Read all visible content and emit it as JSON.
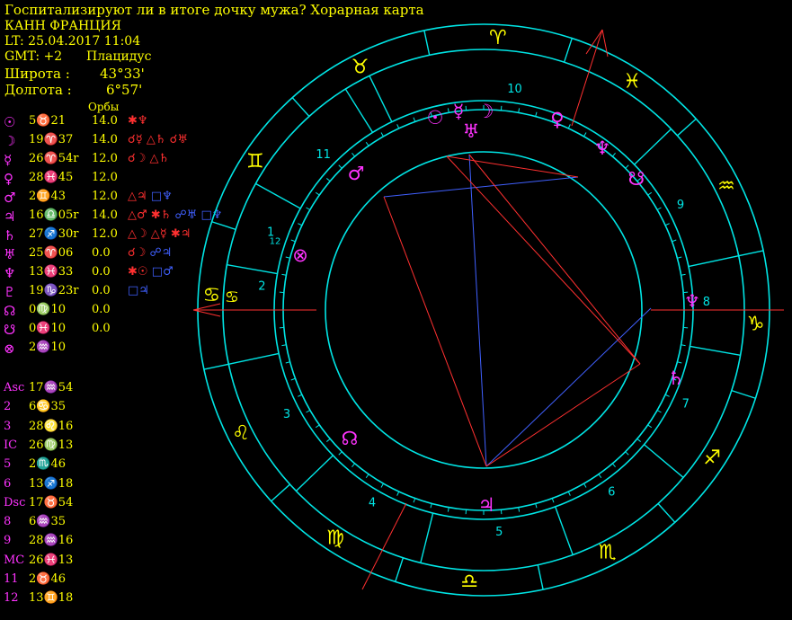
{
  "header": {
    "title": "Госпитализируют ли в итоге дочку мужа? Хорарная карта",
    "place": "КАНН ФРАНЦИЯ",
    "local_time": "LT: 25.04.2017  11:04",
    "gmt": "GMT: +2",
    "house_system": "Плацидус",
    "latitude_label": "Широта :",
    "latitude_value": "43°33'",
    "longitude_label": "Долгота :",
    "longitude_value": "6°57'",
    "orbs_label": "Орбы"
  },
  "planets": [
    {
      "glyph": "☉",
      "pos": "5♉21",
      "orb": "14.0",
      "aspects": [
        {
          "t": "✱♆",
          "c": "red"
        }
      ]
    },
    {
      "glyph": "☽",
      "pos": "19♈37",
      "orb": "14.0",
      "aspects": [
        {
          "t": "☌☿ ",
          "c": "red"
        },
        {
          "t": "△♄ ",
          "c": "red"
        },
        {
          "t": "☌♅",
          "c": "red"
        }
      ]
    },
    {
      "glyph": "☿",
      "pos": "26♈54r",
      "orb": "12.0",
      "aspects": [
        {
          "t": "☌☽ ",
          "c": "red"
        },
        {
          "t": "△♄",
          "c": "red"
        }
      ]
    },
    {
      "glyph": "♀",
      "pos": "28♓45",
      "orb": "12.0",
      "aspects": []
    },
    {
      "glyph": "♂",
      "pos": "2♊43",
      "orb": "12.0",
      "aspects": [
        {
          "t": "△♃ ",
          "c": "red"
        },
        {
          "t": "□♆",
          "c": "blue"
        }
      ]
    },
    {
      "glyph": "♃",
      "pos": "16♎05r",
      "orb": "14.0",
      "aspects": [
        {
          "t": "△♂ ",
          "c": "red"
        },
        {
          "t": "✱♄ ",
          "c": "red"
        },
        {
          "t": "☍♅ ",
          "c": "blue"
        },
        {
          "t": "□♆",
          "c": "blue"
        }
      ]
    },
    {
      "glyph": "♄",
      "pos": "27♐30r",
      "orb": "12.0",
      "aspects": [
        {
          "t": "△☽ ",
          "c": "red"
        },
        {
          "t": "△☿ ",
          "c": "red"
        },
        {
          "t": "✱♃",
          "c": "red"
        }
      ]
    },
    {
      "glyph": "♅",
      "pos": "25♈06",
      "orb": "0.0",
      "aspects": [
        {
          "t": "☌☽ ",
          "c": "red"
        },
        {
          "t": "☍♃",
          "c": "blue"
        }
      ]
    },
    {
      "glyph": "♆",
      "pos": "13♓33",
      "orb": "0.0",
      "aspects": [
        {
          "t": "✱☉ ",
          "c": "red"
        },
        {
          "t": "□♂",
          "c": "blue"
        }
      ]
    },
    {
      "glyph": "♇",
      "pos": "19♑23r",
      "orb": "0.0",
      "aspects": [
        {
          "t": "□♃",
          "c": "blue"
        }
      ]
    },
    {
      "glyph": "☊",
      "pos": "0♍10",
      "orb": "0.0",
      "aspects": []
    },
    {
      "glyph": "☋",
      "pos": "0♓10",
      "orb": "0.0",
      "aspects": []
    },
    {
      "glyph": "⊗",
      "pos": "2♒10",
      "orb": "",
      "aspects": []
    }
  ],
  "houses": [
    {
      "label": "Asc",
      "val": "17♒54"
    },
    {
      "label": "2",
      "val": "6♋35"
    },
    {
      "label": "3",
      "val": "28♌16"
    },
    {
      "label": "IC",
      "val": "26♍13"
    },
    {
      "label": "5",
      "val": "2♏46"
    },
    {
      "label": "6",
      "val": "13♐18"
    },
    {
      "label": "Dsc",
      "val": "17♉54"
    },
    {
      "label": "8",
      "val": "6♒35"
    },
    {
      "label": "9",
      "val": "28♒16"
    },
    {
      "label": "MC",
      "val": "26♓13"
    },
    {
      "label": "11",
      "val": "2♉46"
    },
    {
      "label": "12",
      "val": "13♊18"
    }
  ],
  "wheel": {
    "zodiac_signs": [
      "♈",
      "♓",
      "♒",
      "♑",
      "♐",
      "♏",
      "♎",
      "♍",
      "♌",
      "♋",
      "♊",
      "♉"
    ],
    "house_numbers": [
      "10",
      "9",
      "8",
      "7",
      "6",
      "5",
      "4",
      "3",
      "2",
      "1",
      "12",
      "11"
    ],
    "planet_glyphs": [
      "☉",
      "☿",
      "☽",
      "♅",
      "♀",
      "♆",
      "☋",
      "♂",
      "⊗",
      "♄",
      "☊",
      "♃"
    ],
    "colors": {
      "ring": "#00e5e5",
      "signs": "#ffff00",
      "planets": "#ff33ff",
      "opposition": "#4060ff",
      "trine": "#ff3030"
    }
  }
}
